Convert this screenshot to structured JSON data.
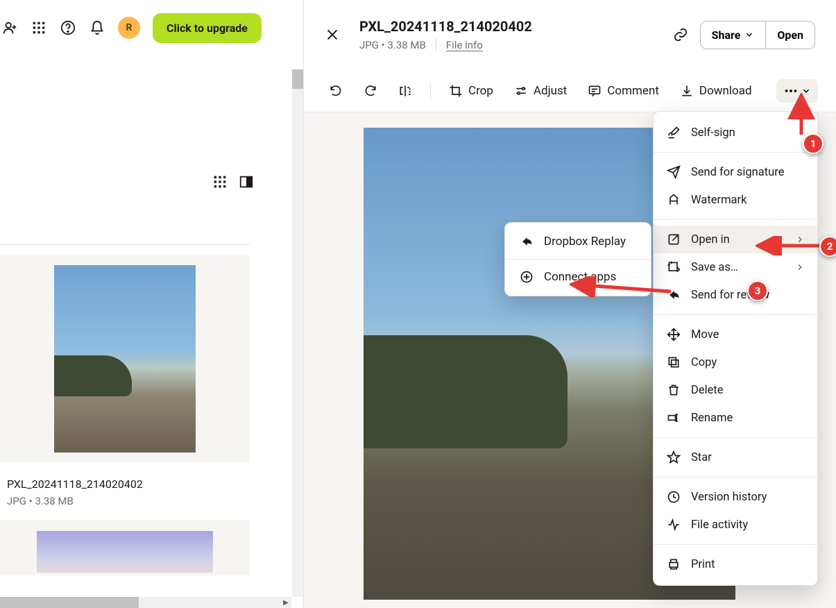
{
  "header": {
    "avatar_initial": "R",
    "upgrade_label": "Click to upgrade"
  },
  "file_item": {
    "name": "PXL_20241118_214020402",
    "meta": "JPG • 3.38 MB"
  },
  "preview": {
    "title": "PXL_20241118_214020402",
    "meta_type_size": "JPG • 3.38 MB",
    "file_info_label": "File info",
    "share_label": "Share",
    "open_label": "Open"
  },
  "toolbar": {
    "crop": "Crop",
    "adjust": "Adjust",
    "comment": "Comment",
    "download": "Download"
  },
  "dropdown": {
    "self_sign": "Self-sign",
    "send_signature": "Send for signature",
    "watermark": "Watermark",
    "open_in": "Open in",
    "save_as": "Save as…",
    "send_review": "Send for review",
    "move": "Move",
    "copy": "Copy",
    "delete": "Delete",
    "rename": "Rename",
    "star": "Star",
    "version_history": "Version history",
    "file_activity": "File activity",
    "print": "Print"
  },
  "submenu": {
    "dropbox_replay": "Dropbox Replay",
    "connect_apps": "Connect apps"
  },
  "annotations": {
    "b1": "1",
    "b2": "2",
    "b3": "3"
  }
}
